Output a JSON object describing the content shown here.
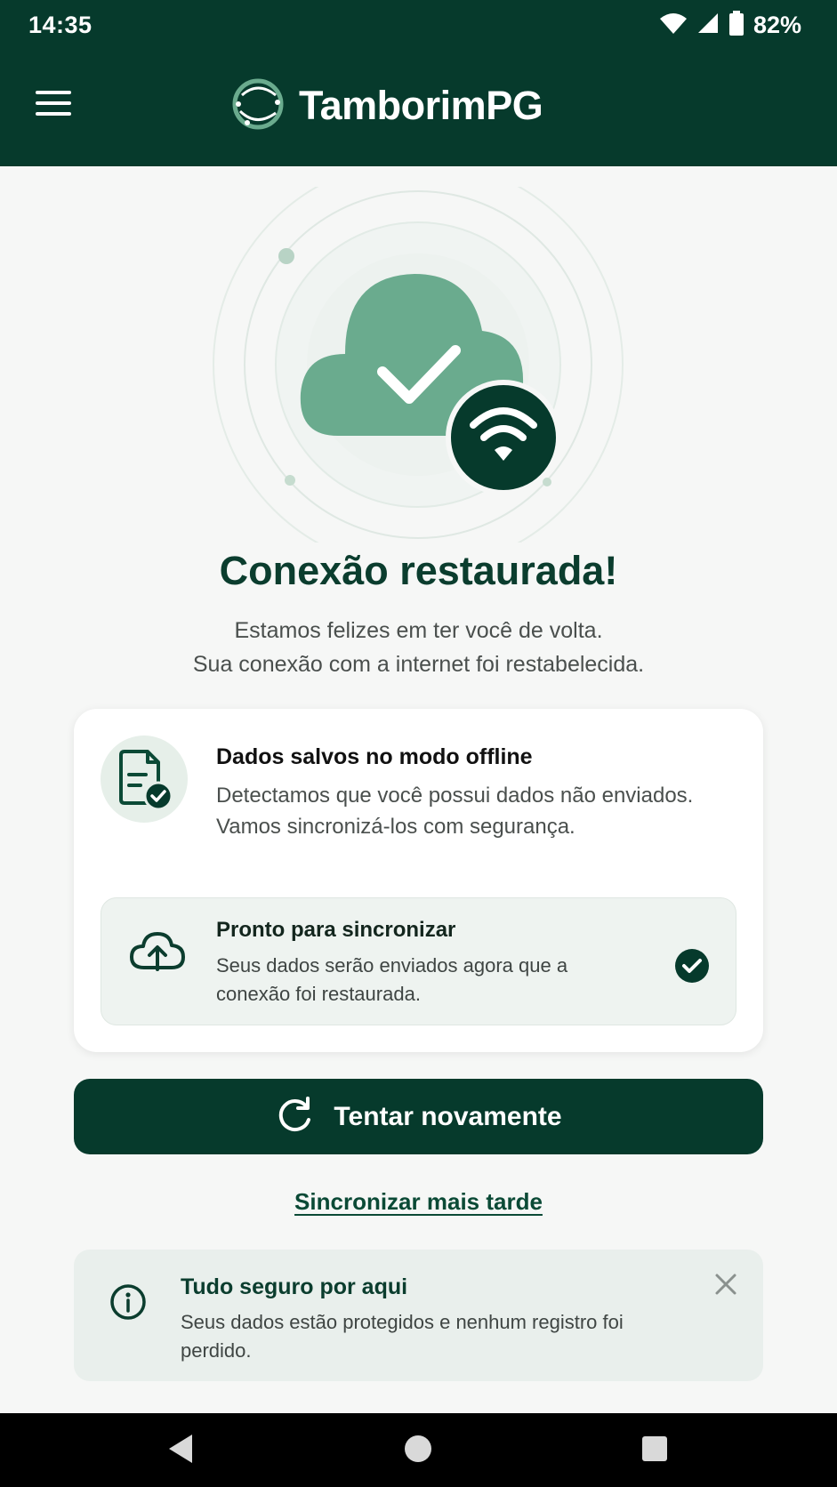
{
  "status_bar": {
    "time": "14:35",
    "battery": "82%",
    "icons": [
      "wifi-icon",
      "signal-icon",
      "battery-icon"
    ]
  },
  "app_bar": {
    "menu_icon": "hamburger-menu-icon",
    "logo_icon": "tamborim-logo-icon",
    "brand_name": "TamborimPG"
  },
  "hero": {
    "icons": [
      "cloud-check-icon",
      "wifi-icon"
    ]
  },
  "header": {
    "title": "Conexão restaurada!",
    "subtitle_line1": "Estamos felizes em ter você de volta.",
    "subtitle_line2": "Sua conexão com a internet foi restabelecida."
  },
  "offline_card": {
    "icon": "document-check-icon",
    "title": "Dados salvos no modo offline",
    "text": "Detectamos que você possui dados não enviados. Vamos sincronizá-los com segurança.",
    "sync": {
      "icon": "cloud-upload-icon",
      "title": "Pronto para sincronizar",
      "text": "Seus dados serão enviados agora que a conexão foi restaurada.",
      "status_icon": "check-circle-icon"
    }
  },
  "actions": {
    "retry_icon": "refresh-icon",
    "retry_label": "Tentar novamente",
    "later_label": "Sincronizar mais tarde"
  },
  "info_banner": {
    "icon": "info-icon",
    "title": "Tudo seguro por aqui",
    "text": "Seus dados estão protegidos e nenhum registro foi perdido.",
    "close_icon": "close-icon"
  },
  "nav_bar": {
    "buttons": [
      "back-icon",
      "home-icon",
      "recents-icon"
    ]
  },
  "colors": {
    "primary": "#063a2c",
    "accent_light": "#6aab8e",
    "background": "#f6f7f6"
  }
}
